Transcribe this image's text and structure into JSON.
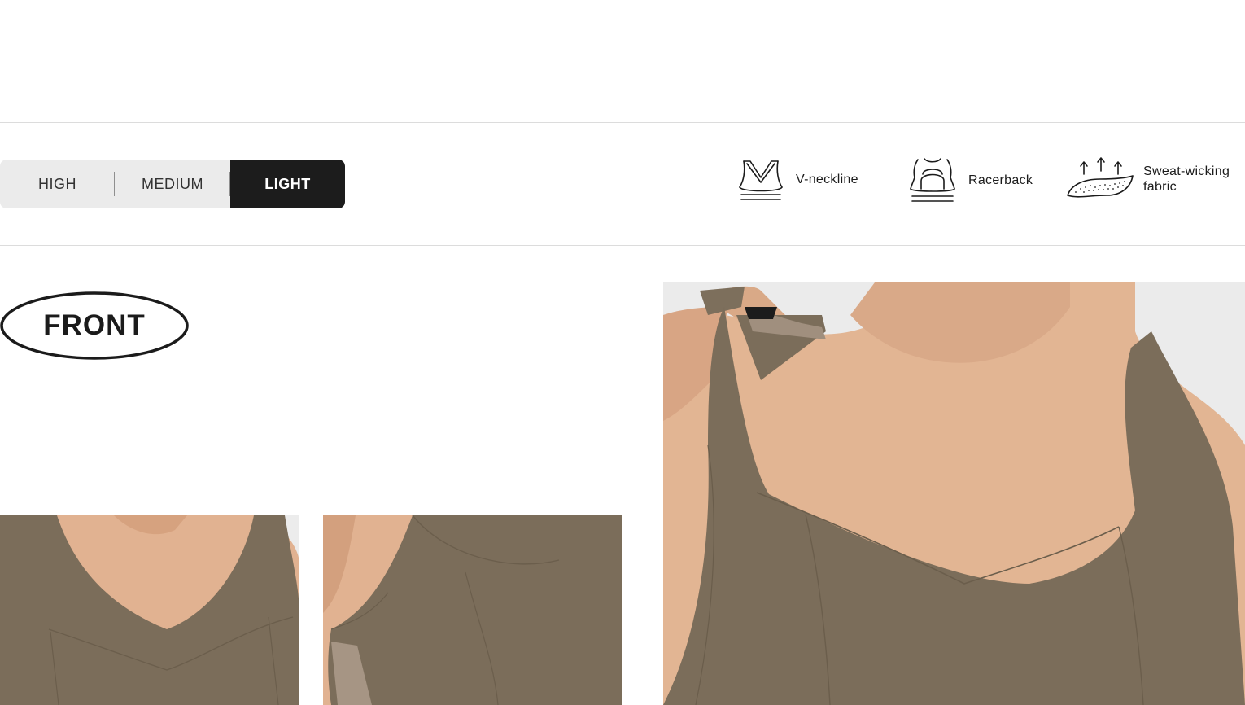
{
  "support_levels": {
    "options": [
      "HIGH",
      "MEDIUM",
      "LIGHT"
    ],
    "selected": "LIGHT"
  },
  "features": [
    {
      "icon": "v-neckline-icon",
      "label": "V-neckline"
    },
    {
      "icon": "racerback-icon",
      "label": "Racerback"
    },
    {
      "icon": "sweat-wicking-icon",
      "label": "Sweat-wicking fabric"
    }
  ],
  "view_badge": {
    "label": "FRONT"
  },
  "photos": [
    {
      "subject": "front detail crop"
    },
    {
      "subject": "side detail crop"
    },
    {
      "subject": "model wearing bra, front view"
    }
  ],
  "colors": {
    "fabric": "#7d6e5a",
    "skin": "#e2b593",
    "dark": "#1c1c1c",
    "control_bg": "#ebebeb"
  }
}
